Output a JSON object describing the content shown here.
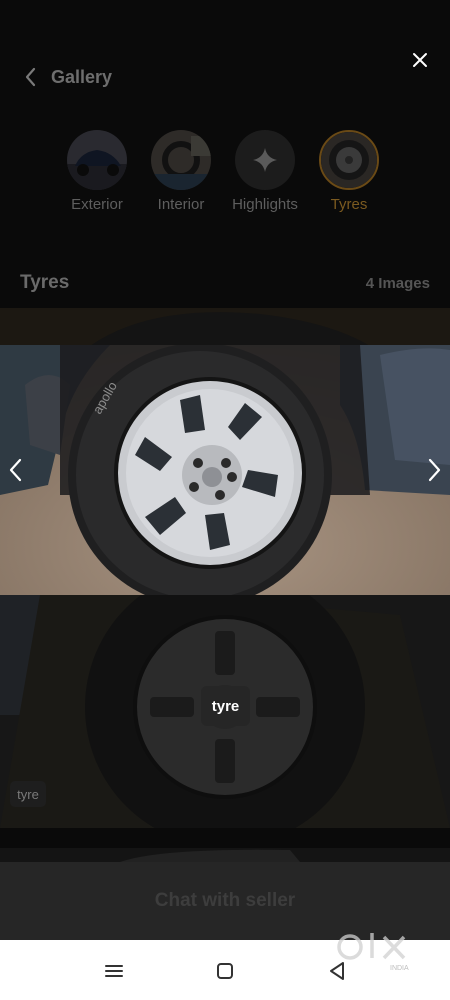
{
  "header": {
    "title": "Gallery"
  },
  "categories": [
    {
      "label": "Exterior",
      "active": false
    },
    {
      "label": "Interior",
      "active": false
    },
    {
      "label": "Highlights",
      "active": false
    },
    {
      "label": "Tyres",
      "active": true
    }
  ],
  "section": {
    "title": "Tyres",
    "count": "4 Images"
  },
  "tags": {
    "center": "tyre",
    "bottom": "tyre"
  },
  "chat": {
    "label": "Chat with seller"
  },
  "watermark": {
    "brand": "olx",
    "sub": "INDIA"
  }
}
